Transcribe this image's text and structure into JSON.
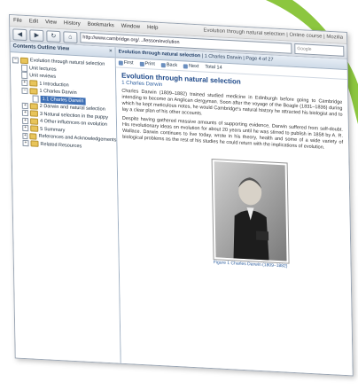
{
  "menu": [
    "File",
    "Edit",
    "View",
    "History",
    "Bookmarks",
    "Window",
    "Help"
  ],
  "window_title": "Evolution through natural selection | Online course | Mozilla",
  "url": "http://www.cambridge.org/.../lesson/evolution",
  "search_placeholder": "Google",
  "outline": {
    "title": "Contents Outline View",
    "close": "×",
    "items": [
      {
        "label": "Evolution through natural selection",
        "level": 0,
        "expander": "−",
        "type": "folder"
      },
      {
        "label": "Unit lectures",
        "level": 1,
        "type": "doc"
      },
      {
        "label": "Unit reviews",
        "level": 1,
        "type": "doc"
      },
      {
        "label": "1 Introduction",
        "level": 1,
        "expander": "+",
        "type": "folder"
      },
      {
        "label": "1 Charles Darwin",
        "level": 1,
        "expander": "−",
        "type": "folder"
      },
      {
        "label": "1.1 Charles Darwin",
        "level": 2,
        "type": "doc",
        "selected": true
      },
      {
        "label": "2 Darwin and natural selection",
        "level": 1,
        "expander": "+",
        "type": "folder"
      },
      {
        "label": "3 Natural selection in the puppy",
        "level": 1,
        "expander": "+",
        "type": "folder"
      },
      {
        "label": "4 Other influences on evolution",
        "level": 1,
        "expander": "+",
        "type": "folder"
      },
      {
        "label": "5 Summary",
        "level": 1,
        "expander": "+",
        "type": "folder"
      },
      {
        "label": "References and Acknowledgements",
        "level": 1,
        "expander": "+",
        "type": "folder"
      },
      {
        "label": "Related Resources",
        "level": 1,
        "expander": "+",
        "type": "folder"
      }
    ]
  },
  "content": {
    "tab_bold": "Evolution through natural selection",
    "tab_rest": " | 1 Charles Darwin | Page 4 of 27",
    "toolbar": [
      "First",
      "Print",
      "Back",
      "Next",
      "Total 14"
    ],
    "heading": "Evolution through natural selection",
    "author": "1 Charles Darwin",
    "paragraphs": [
      "Charles Darwin (1809–1882) trained studied medicine in Edinburgh before going to Cambridge intending to become an Anglican clergyman. Soon after the voyage of the Beagle (1831–1836) during which he kept meticulous notes, he would Cambridge's natural history he attracted his biologist and to lay a clear plan of his other accounts.",
      "Despite having gathered massive amounts of supporting evidence, Darwin suffered from self-doubt. His revolutionary ideas on evolution for about 20 years until he was stirred to publish in 1858 by A. R. Wallace. Darwin continues to live today, wrote in his theory, health and some of a wide variety of biological problems as the rest of his studies he could return with the implications of evolution."
    ],
    "caption": "Figure 1 Charles Darwin (1809–1882)"
  },
  "colors": {
    "accent": "#3d6fb5",
    "heading": "#1f4a8a",
    "swoosh": "#8cc63f"
  }
}
